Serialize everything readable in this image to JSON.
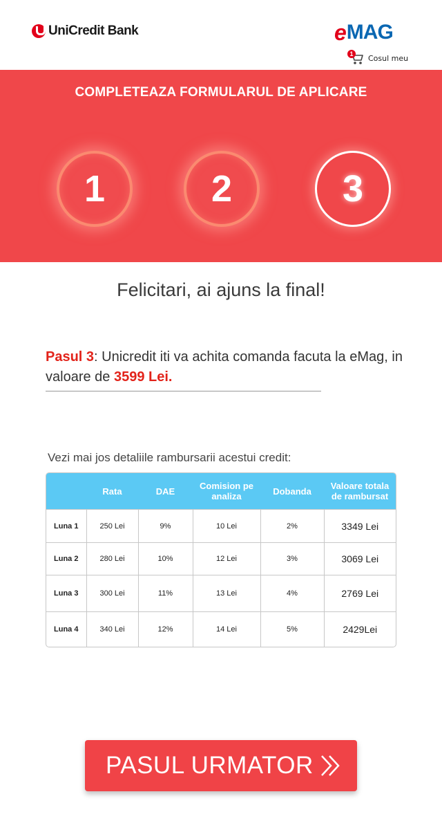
{
  "header": {
    "bank_logo_text": "UniCredit Bank",
    "store_logo_e": "e",
    "store_logo_mag": "MAG",
    "cart_label": "Cosul meu",
    "cart_count": "1"
  },
  "banner": {
    "title": "COMPLETEAZA FORMULARUL DE APLICARE",
    "steps": [
      {
        "number": "1",
        "state": "completed"
      },
      {
        "number": "2",
        "state": "completed"
      },
      {
        "number": "3",
        "state": "active"
      }
    ]
  },
  "main": {
    "congrats": "Felicitari, ai ajuns la final!",
    "step_label": "Pasul 3",
    "step_text": ": Unicredit iti va achita comanda facuta la eMag, in valoare de ",
    "amount": "3599 Lei.",
    "table_caption": "Vezi mai jos detaliile rambursarii acestui credit:"
  },
  "table": {
    "headers": [
      "",
      "Rata",
      "DAE",
      "Comision pe analiza",
      "Dobanda",
      "Valoare totala de rambursat"
    ],
    "rows": [
      [
        "Luna 1",
        "250 Lei",
        "9%",
        "10 Lei",
        "2%",
        "3349 Lei"
      ],
      [
        "Luna 2",
        "280 Lei",
        "10%",
        "12 Lei",
        "3%",
        "3069 Lei"
      ],
      [
        "Luna 3",
        "300 Lei",
        "11%",
        "13 Lei",
        "4%",
        "2769 Lei"
      ],
      [
        "Luna 4",
        "340 Lei",
        "12%",
        "14 Lei",
        "5%",
        "2429Lei"
      ]
    ]
  },
  "footer": {
    "next_button_label": "PASUL URMATOR"
  },
  "colors": {
    "brand_red": "#f0474a",
    "table_header": "#5bc9f4",
    "accent_text_red": "#e2231a",
    "emag_blue": "#0a67b2"
  }
}
